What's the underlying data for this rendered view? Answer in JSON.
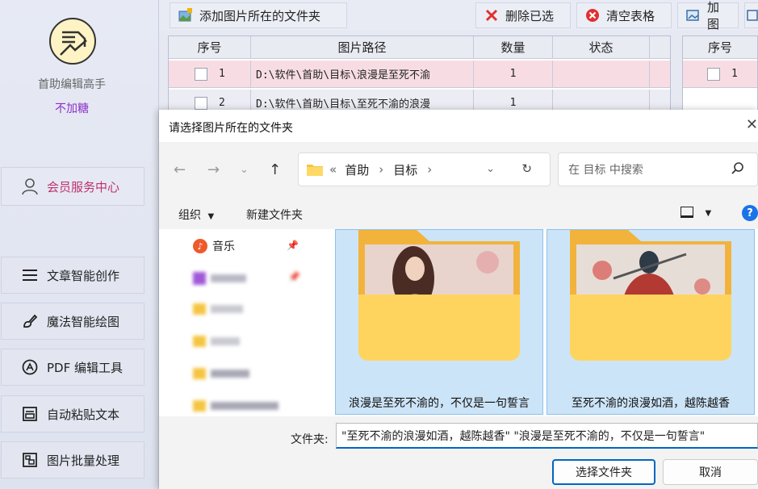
{
  "app": {
    "name": "首助编辑高手",
    "subtitle": "不加糖"
  },
  "sidebar": {
    "member_center": "会员服务中心",
    "items": [
      {
        "label": "文章智能创作",
        "icon": "menu-lines-icon"
      },
      {
        "label": "魔法智能绘图",
        "icon": "brush-icon"
      },
      {
        "label": "PDF 编辑工具",
        "icon": "pdf-logo-icon"
      },
      {
        "label": "自动粘贴文本",
        "icon": "paste-text-icon"
      },
      {
        "label": "图片批量处理",
        "icon": "image-batch-icon"
      }
    ]
  },
  "toolbar": {
    "add_folder": "添加图片所在的文件夹",
    "delete_selected": "删除已选",
    "clear_table": "清空表格",
    "add_image": "加图"
  },
  "table": {
    "headers": [
      "序号",
      "图片路径",
      "数量",
      "状态"
    ],
    "rows": [
      {
        "index": "1",
        "path": "D:\\软件\\首助\\目标\\浪漫是至死不渝",
        "qty": "1",
        "status": ""
      },
      {
        "index": "2",
        "path": "D:\\软件\\首助\\目标\\至死不渝的浪漫",
        "qty": "1",
        "status": ""
      }
    ]
  },
  "table2": {
    "header": "序号",
    "rows": [
      {
        "index": "1"
      }
    ]
  },
  "dialog": {
    "title": "请选择图片所在的文件夹",
    "breadcrumb": [
      "首助",
      "目标"
    ],
    "search_placeholder": "在 目标 中搜索",
    "organize": "组织",
    "new_folder": "新建文件夹",
    "tree": [
      {
        "label": "音乐"
      }
    ],
    "folders": [
      {
        "name": "浪漫是至死不渝的，不仅是一句誓言"
      },
      {
        "name": "至死不渝的浪漫如酒，越陈越香"
      }
    ],
    "folder_label": "文件夹:",
    "folder_value": "\"至死不渝的浪漫如酒，越陈越香\" \"浪漫是至死不渝的，不仅是一句誓言\"",
    "select_button": "选择文件夹",
    "cancel_button": "取消"
  },
  "colors": {
    "accent": "#0067c0",
    "member": "#c0306b",
    "subtitle": "#8b2fc9",
    "selected_row": "#f7dde3"
  }
}
